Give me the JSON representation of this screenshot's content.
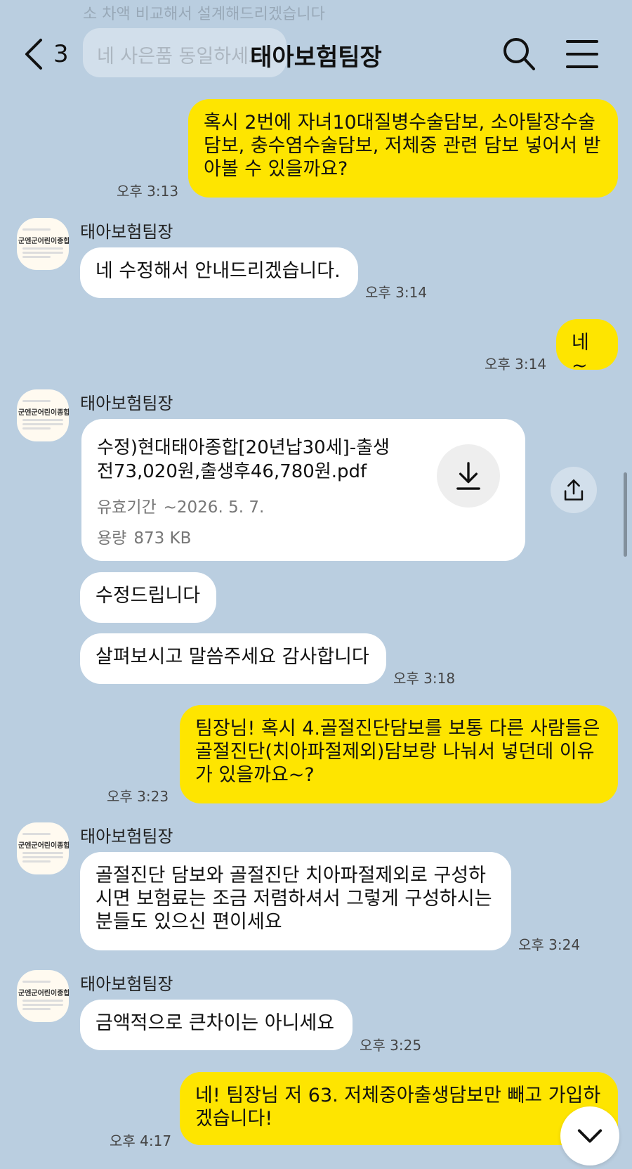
{
  "header": {
    "back_count": "3",
    "title": "태아보험팀장",
    "ghost_text": "네 사은품 동일하세요",
    "ghost_top": "소 차액 비교해서 설계해드리겠습니다"
  },
  "avatar": {
    "label": "군엔군어린이종합보험"
  },
  "messages": [
    {
      "sender": "me",
      "text": "혹시 2번에 자녀10대질병수술담보, 소아탈장수술\n담보, 충수염수술담보, 저체중 관련 담보 넣어서 받\n아볼 수 있을까요?",
      "time": "오후 3:13"
    },
    {
      "sender_name": "태아보험팀장",
      "text": "네 수정해서 안내드리겠습니다.",
      "time": "오후 3:14"
    },
    {
      "sender": "me",
      "text": "네~",
      "time": "오후 3:14"
    },
    {
      "sender_name": "태아보험팀장"
    },
    {
      "text": "수정드립니다"
    },
    {
      "text": "살펴보시고 말씀주세요 감사합니다",
      "time": "오후 3:18"
    },
    {
      "sender": "me",
      "text": "팀장님! 혹시 4.골절진단담보를 보통 다른 사람들은\n골절진단(치아파절제외)담보랑 나눠서 넣던데 이유\n가 있을까요~?",
      "time": "오후 3:23"
    },
    {
      "sender_name": "태아보험팀장",
      "text": "골절진단 담보와 골절진단 치아파절제외로 구성하\n시면 보험료는 조금 저렴하셔서 그렇게 구성하시는\n분들도 있으신 편이세요",
      "time": "오후 3:24"
    },
    {
      "sender_name": "태아보험팀장",
      "text": "금액적으로 큰차이는 아니세요",
      "time": "오후 3:25"
    },
    {
      "sender": "me",
      "text": "네! 팀장님 저 63. 저체중아출생담보만 빼고 가입하\n겠습니다!",
      "time": "오후 4:17"
    }
  ],
  "file": {
    "name": "수정)현대태아종합[20년납30세]-출생\n전73,020원,출생후46,780원.pdf",
    "validity_label": "유효기간",
    "validity_value": "~2026. 5. 7.",
    "size_label": "용량",
    "size_value": "873 KB"
  },
  "icons": {
    "back": "chevron-left-icon",
    "search": "search-icon",
    "menu": "hamburger-menu-icon",
    "download": "download-icon",
    "share": "share-icon",
    "scroll_down": "chevron-down-icon"
  },
  "colors": {
    "background": "#bacee0",
    "my_bubble": "#fee500",
    "their_bubble": "#ffffff"
  }
}
